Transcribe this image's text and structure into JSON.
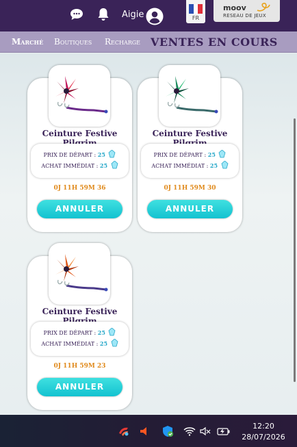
{
  "header": {
    "username": "Aigie",
    "language": "FR",
    "partner": {
      "brand": "moov",
      "network": "RESEAU DE JEUX"
    },
    "icons": [
      "chat-icon",
      "bell-icon",
      "account-icon"
    ]
  },
  "nav": {
    "items": [
      {
        "label": "Marché",
        "active": true
      },
      {
        "label": "Boutiques",
        "active": false
      },
      {
        "label": "Recharge",
        "active": false
      }
    ],
    "section_title": "VENTES EN COURS"
  },
  "listings": [
    {
      "name": "Ceinture Festive Pilgrim",
      "start_label": "PRIX DE DÉPART :",
      "start_price": "25",
      "buyout_label": "ACHAT IMMÉDIAT :",
      "buyout_price": "25",
      "timer": "0J 11H 59M 36",
      "cancel_label": "ANNULER",
      "variant": "red"
    },
    {
      "name": "Ceinture Festive Pilgrim",
      "start_label": "PRIX DE DÉPART :",
      "start_price": "25",
      "buyout_label": "ACHAT IMMÉDIAT :",
      "buyout_price": "25",
      "timer": "0J 11H 59M 30",
      "cancel_label": "ANNULER",
      "variant": "green"
    },
    {
      "name": "Ceinture Festive Pilgrim",
      "start_label": "PRIX DE DÉPART :",
      "start_price": "25",
      "buyout_label": "ACHAT IMMÉDIAT :",
      "buyout_price": "25",
      "timer": "0J 11H 59M 23",
      "cancel_label": "ANNULER",
      "variant": "orange"
    }
  ],
  "taskbar": {
    "time": "12:20",
    "date": "28/07/2026",
    "icons": [
      "game-icon",
      "audio-device-icon",
      "shield-icon",
      "wifi-icon",
      "mute-icon",
      "battery-icon"
    ]
  },
  "colors": {
    "header_bg": "#3a2358",
    "nav_bg": "#a89cc0",
    "accent_cyan": "#13c2d0",
    "price_blue": "#25a7c8",
    "timer_orange": "#e08a1c"
  }
}
